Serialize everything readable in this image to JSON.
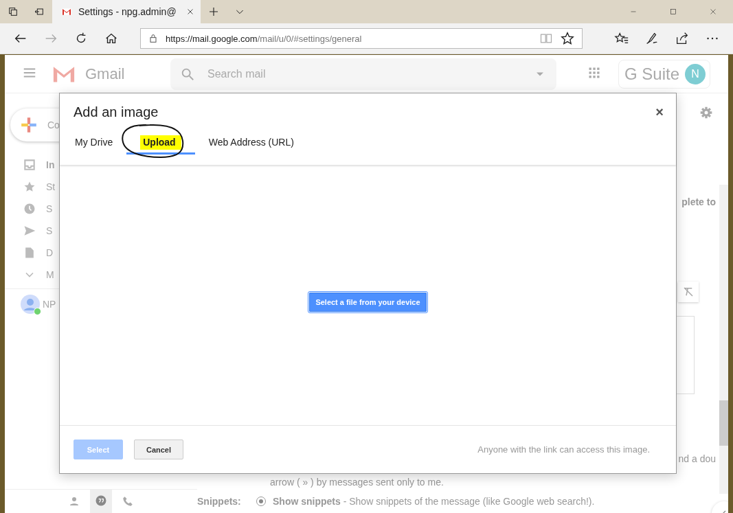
{
  "browser": {
    "tab_title": "Settings - npg.admin@",
    "url_host": "https://mail.google.com",
    "url_path": "/mail/u/0/#settings/general"
  },
  "gmail": {
    "logo": "Gmail",
    "search": {
      "placeholder": "Search mail"
    },
    "suite": "G Suite",
    "avatar": "N",
    "compose": "Co",
    "nav": [
      {
        "kind": "inbox",
        "label": "In",
        "bold": true
      },
      {
        "kind": "star",
        "label": "St",
        "bold": false
      },
      {
        "kind": "clock",
        "label": "S",
        "bold": false
      },
      {
        "kind": "send",
        "label": "S",
        "bold": false
      },
      {
        "kind": "file",
        "label": "D",
        "bold": false
      },
      {
        "kind": "more",
        "label": "M",
        "bold": false
      }
    ],
    "account": "NP",
    "settings_lines": [
      "plete to",
      "nd a dou",
      "arrow ( » ) by messages sent only to me."
    ],
    "snippets": {
      "label": "Snippets:",
      "option": "Show snippets",
      "description": " - Show snippets of the message (like Google web search!).",
      "selected": true
    }
  },
  "dialog": {
    "title": "Add an image",
    "close": "×",
    "tabs": [
      {
        "label": "My Drive",
        "selected": false,
        "annotated": false
      },
      {
        "label": "Upload",
        "selected": true,
        "annotated": true
      },
      {
        "label": "Web Address (URL)",
        "selected": false,
        "annotated": false
      }
    ],
    "upload_button": "Select a file from your device",
    "select_button": {
      "label": "Select",
      "disabled": true
    },
    "cancel_button": "Cancel",
    "note": "Anyone with the link can access this image."
  }
}
